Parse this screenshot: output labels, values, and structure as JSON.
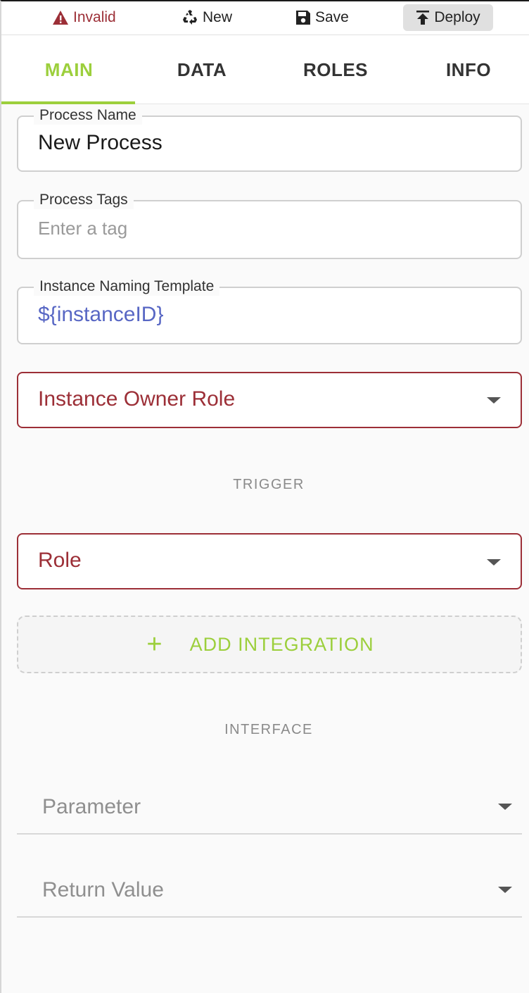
{
  "toolbar": {
    "invalid_label": "Invalid",
    "new_label": "New",
    "save_label": "Save",
    "deploy_label": "Deploy"
  },
  "tabs": [
    {
      "label": "MAIN",
      "active": true
    },
    {
      "label": "DATA",
      "active": false
    },
    {
      "label": "ROLES",
      "active": false
    },
    {
      "label": "INFO",
      "active": false
    }
  ],
  "form": {
    "process_name": {
      "label": "Process Name",
      "value": "New Process"
    },
    "process_tags": {
      "label": "Process Tags",
      "placeholder": "Enter a tag"
    },
    "naming_template": {
      "label": "Instance Naming Template",
      "value": "${instanceID}"
    },
    "owner_role": {
      "label": "Instance Owner Role"
    }
  },
  "trigger": {
    "section_title": "TRIGGER",
    "role_label": "Role",
    "add_integration_label": "ADD INTEGRATION",
    "add_icon": "plus-icon"
  },
  "interface": {
    "section_title": "INTERFACE",
    "parameter_label": "Parameter",
    "return_value_label": "Return Value"
  },
  "colors": {
    "accent": "#9ccf3c",
    "error": "#9c2f37",
    "template": "#5867c4"
  },
  "icons": {
    "invalid": "warning-icon",
    "new": "recycle-icon",
    "save": "floppy-disk-icon",
    "deploy": "upload-icon",
    "dropdown": "caret-down-icon"
  }
}
